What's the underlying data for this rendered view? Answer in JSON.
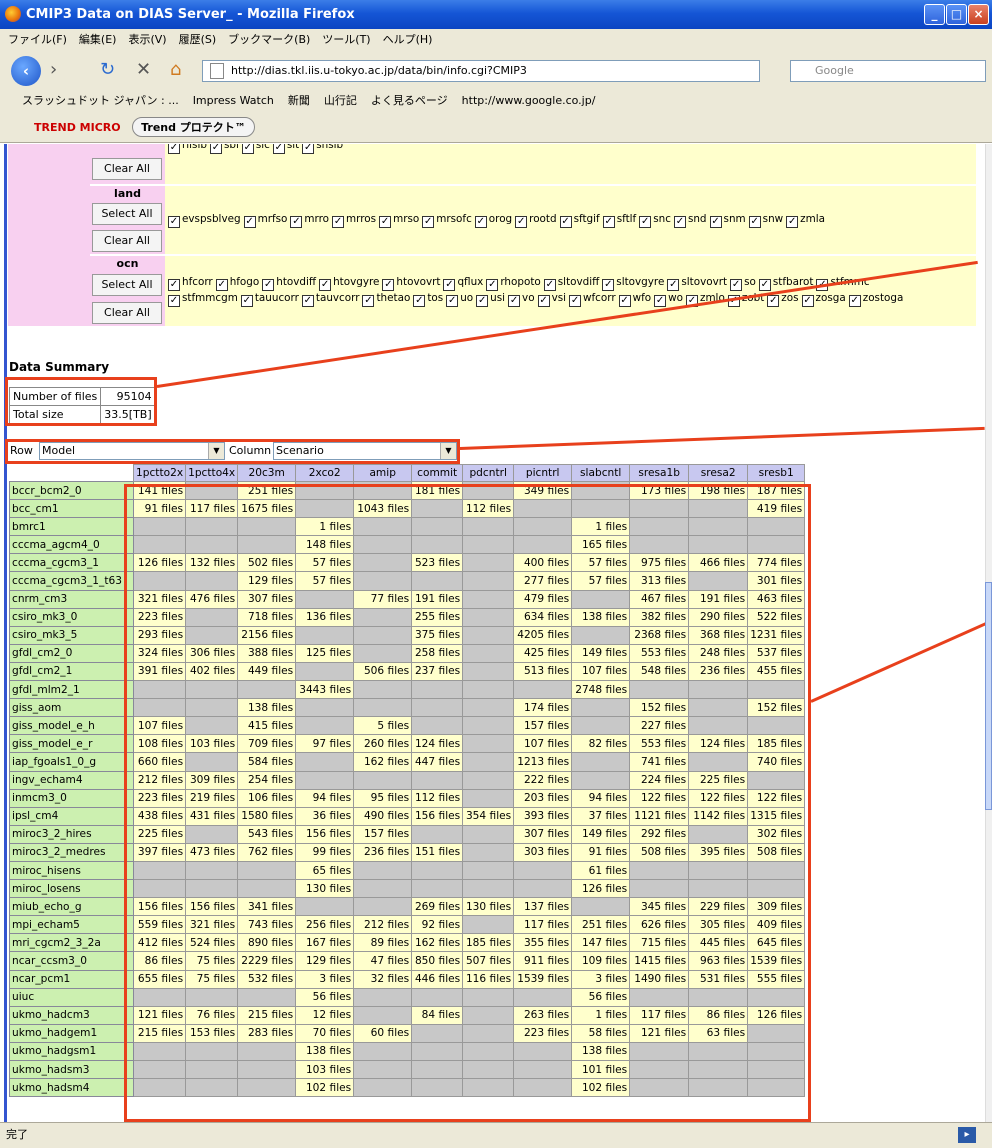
{
  "window": {
    "title": "CMIP3 Data on DIAS Server_ - Mozilla Firefox"
  },
  "menu": [
    "ファイル(F)",
    "編集(E)",
    "表示(V)",
    "履歴(S)",
    "ブックマーク(B)",
    "ツール(T)",
    "ヘルプ(H)"
  ],
  "nav": {
    "url": "http://dias.tkl.iis.u-tokyo.ac.jp/data/bin/info.cgi?CMIP3",
    "search_placeholder": "Google"
  },
  "bookmarks": [
    "スラッシュドット ジャパン : ...",
    "Impress Watch",
    "新聞",
    "山行記",
    "よく見るページ",
    "http://www.google.co.jp/"
  ],
  "trend": {
    "brand": "TREND MICRO",
    "button": "Trend プロテクト™"
  },
  "status": "完了",
  "variables": {
    "partial_top": [
      "rlisib",
      "sbl",
      "sic",
      "sit",
      "snsib"
    ],
    "groups": [
      {
        "name": "land",
        "vars": [
          "evspsblveg",
          "mrfso",
          "mrro",
          "mrros",
          "mrso",
          "mrsofc",
          "orog",
          "rootd",
          "sftgif",
          "sftlf",
          "snc",
          "snd",
          "snm",
          "snw",
          "zmla"
        ]
      },
      {
        "name": "ocn",
        "vars": [
          "hfcorr",
          "hfogo",
          "htovdiff",
          "htovgyre",
          "htovovrt",
          "qflux",
          "rhopoto",
          "sltovdiff",
          "sltovgyre",
          "sltovovrt",
          "so",
          "stfbarot",
          "stfmmc",
          "stfmmcgm",
          "tauucorr",
          "tauvcorr",
          "thetao",
          "tos",
          "uo",
          "usi",
          "vo",
          "vsi",
          "wfcorr",
          "wfo",
          "wo",
          "zmlo",
          "zobt",
          "zos",
          "zosga",
          "zostoga"
        ]
      }
    ],
    "select_all": "Select All",
    "clear_all": "Clear All"
  },
  "summary": {
    "title": "Data Summary",
    "files_label": "Number of files",
    "files_value": "95104",
    "size_label": "Total size",
    "size_value": "33.5[TB]"
  },
  "selectors": {
    "row_label": "Row",
    "row_value": "Model",
    "column_label": "Column",
    "column_value": "Scenario"
  },
  "table": {
    "columns": [
      "1pctto2x",
      "1pctto4x",
      "20c3m",
      "2xco2",
      "amip",
      "commit",
      "pdcntrl",
      "picntrl",
      "slabcntl",
      "sresa1b",
      "sresa2",
      "sresb1"
    ],
    "rows": [
      {
        "model": "bccr_bcm2_0",
        "cells": [
          "141 files",
          "",
          "251 files",
          "",
          "",
          "181 files",
          "",
          "349 files",
          "",
          "173 files",
          "198 files",
          "187 files"
        ]
      },
      {
        "model": "bcc_cm1",
        "cells": [
          "91 files",
          "117 files",
          "1675 files",
          "",
          "1043 files",
          "",
          "112 files",
          "",
          "",
          "",
          "",
          "419 files"
        ]
      },
      {
        "model": "bmrc1",
        "cells": [
          "",
          "",
          "",
          "1 files",
          "",
          "",
          "",
          "",
          "1 files",
          "",
          "",
          ""
        ]
      },
      {
        "model": "cccma_agcm4_0",
        "cells": [
          "",
          "",
          "",
          "148 files",
          "",
          "",
          "",
          "",
          "165 files",
          "",
          "",
          ""
        ]
      },
      {
        "model": "cccma_cgcm3_1",
        "cells": [
          "126 files",
          "132 files",
          "502 files",
          "57 files",
          "",
          "523 files",
          "",
          "400 files",
          "57 files",
          "975 files",
          "466 files",
          "774 files"
        ]
      },
      {
        "model": "cccma_cgcm3_1_t63",
        "cells": [
          "",
          "",
          "129 files",
          "57 files",
          "",
          "",
          "",
          "277 files",
          "57 files",
          "313 files",
          "",
          "301 files"
        ]
      },
      {
        "model": "cnrm_cm3",
        "cells": [
          "321 files",
          "476 files",
          "307 files",
          "",
          "77 files",
          "191 files",
          "",
          "479 files",
          "",
          "467 files",
          "191 files",
          "463 files"
        ]
      },
      {
        "model": "csiro_mk3_0",
        "cells": [
          "223 files",
          "",
          "718 files",
          "136 files",
          "",
          "255 files",
          "",
          "634 files",
          "138 files",
          "382 files",
          "290 files",
          "522 files"
        ]
      },
      {
        "model": "csiro_mk3_5",
        "cells": [
          "293 files",
          "",
          "2156 files",
          "",
          "",
          "375 files",
          "",
          "4205 files",
          "",
          "2368 files",
          "368 files",
          "1231 files"
        ]
      },
      {
        "model": "gfdl_cm2_0",
        "cells": [
          "324 files",
          "306 files",
          "388 files",
          "125 files",
          "",
          "258 files",
          "",
          "425 files",
          "149 files",
          "553 files",
          "248 files",
          "537 files"
        ]
      },
      {
        "model": "gfdl_cm2_1",
        "cells": [
          "391 files",
          "402 files",
          "449 files",
          "",
          "506 files",
          "237 files",
          "",
          "513 files",
          "107 files",
          "548 files",
          "236 files",
          "455 files"
        ]
      },
      {
        "model": "gfdl_mlm2_1",
        "cells": [
          "",
          "",
          "",
          "3443 files",
          "",
          "",
          "",
          "",
          "2748 files",
          "",
          "",
          ""
        ]
      },
      {
        "model": "giss_aom",
        "cells": [
          "",
          "",
          "138 files",
          "",
          "",
          "",
          "",
          "174 files",
          "",
          "152 files",
          "",
          "152 files"
        ]
      },
      {
        "model": "giss_model_e_h",
        "cells": [
          "107 files",
          "",
          "415 files",
          "",
          "5 files",
          "",
          "",
          "157 files",
          "",
          "227 files",
          "",
          ""
        ]
      },
      {
        "model": "giss_model_e_r",
        "cells": [
          "108 files",
          "103 files",
          "709 files",
          "97 files",
          "260 files",
          "124 files",
          "",
          "107 files",
          "82 files",
          "553 files",
          "124 files",
          "185 files"
        ]
      },
      {
        "model": "iap_fgoals1_0_g",
        "cells": [
          "660 files",
          "",
          "584 files",
          "",
          "162 files",
          "447 files",
          "",
          "1213 files",
          "",
          "741 files",
          "",
          "740 files"
        ]
      },
      {
        "model": "ingv_echam4",
        "cells": [
          "212 files",
          "309 files",
          "254 files",
          "",
          "",
          "",
          "",
          "222 files",
          "",
          "224 files",
          "225 files",
          ""
        ]
      },
      {
        "model": "inmcm3_0",
        "cells": [
          "223 files",
          "219 files",
          "106 files",
          "94 files",
          "95 files",
          "112 files",
          "",
          "203 files",
          "94 files",
          "122 files",
          "122 files",
          "122 files"
        ]
      },
      {
        "model": "ipsl_cm4",
        "cells": [
          "438 files",
          "431 files",
          "1580 files",
          "36 files",
          "490 files",
          "156 files",
          "354 files",
          "393 files",
          "37 files",
          "1121 files",
          "1142 files",
          "1315 files"
        ]
      },
      {
        "model": "miroc3_2_hires",
        "cells": [
          "225 files",
          "",
          "543 files",
          "156 files",
          "157 files",
          "",
          "",
          "307 files",
          "149 files",
          "292 files",
          "",
          "302 files"
        ]
      },
      {
        "model": "miroc3_2_medres",
        "cells": [
          "397 files",
          "473 files",
          "762 files",
          "99 files",
          "236 files",
          "151 files",
          "",
          "303 files",
          "91 files",
          "508 files",
          "395 files",
          "508 files"
        ]
      },
      {
        "model": "miroc_hisens",
        "cells": [
          "",
          "",
          "",
          "65 files",
          "",
          "",
          "",
          "",
          "61 files",
          "",
          "",
          ""
        ]
      },
      {
        "model": "miroc_losens",
        "cells": [
          "",
          "",
          "",
          "130 files",
          "",
          "",
          "",
          "",
          "126 files",
          "",
          "",
          ""
        ]
      },
      {
        "model": "miub_echo_g",
        "cells": [
          "156 files",
          "156 files",
          "341 files",
          "",
          "",
          "269 files",
          "130 files",
          "137 files",
          "",
          "345 files",
          "229 files",
          "309 files"
        ]
      },
      {
        "model": "mpi_echam5",
        "cells": [
          "559 files",
          "321 files",
          "743 files",
          "256 files",
          "212 files",
          "92 files",
          "",
          "117 files",
          "251 files",
          "626 files",
          "305 files",
          "409 files"
        ]
      },
      {
        "model": "mri_cgcm2_3_2a",
        "cells": [
          "412 files",
          "524 files",
          "890 files",
          "167 files",
          "89 files",
          "162 files",
          "185 files",
          "355 files",
          "147 files",
          "715 files",
          "445 files",
          "645 files"
        ]
      },
      {
        "model": "ncar_ccsm3_0",
        "cells": [
          "86 files",
          "75 files",
          "2229 files",
          "129 files",
          "47 files",
          "850 files",
          "507 files",
          "911 files",
          "109 files",
          "1415 files",
          "963 files",
          "1539 files"
        ]
      },
      {
        "model": "ncar_pcm1",
        "cells": [
          "655 files",
          "75 files",
          "532 files",
          "3 files",
          "32 files",
          "446 files",
          "116 files",
          "1539 files",
          "3 files",
          "1490 files",
          "531 files",
          "555 files"
        ]
      },
      {
        "model": "uiuc",
        "cells": [
          "",
          "",
          "",
          "56 files",
          "",
          "",
          "",
          "",
          "56 files",
          "",
          "",
          ""
        ]
      },
      {
        "model": "ukmo_hadcm3",
        "cells": [
          "121 files",
          "76 files",
          "215 files",
          "12 files",
          "",
          "84 files",
          "",
          "263 files",
          "1 files",
          "117 files",
          "86 files",
          "126 files"
        ]
      },
      {
        "model": "ukmo_hadgem1",
        "cells": [
          "215 files",
          "153 files",
          "283 files",
          "70 files",
          "60 files",
          "",
          "",
          "223 files",
          "58 files",
          "121 files",
          "63 files",
          ""
        ]
      },
      {
        "model": "ukmo_hadgsm1",
        "cells": [
          "",
          "",
          "",
          "138 files",
          "",
          "",
          "",
          "",
          "138 files",
          "",
          "",
          ""
        ]
      },
      {
        "model": "ukmo_hadsm3",
        "cells": [
          "",
          "",
          "",
          "103 files",
          "",
          "",
          "",
          "",
          "101 files",
          "",
          "",
          ""
        ]
      },
      {
        "model": "ukmo_hadsm4",
        "cells": [
          "",
          "",
          "",
          "102 files",
          "",
          "",
          "",
          "",
          "102 files",
          "",
          "",
          ""
        ]
      }
    ]
  }
}
